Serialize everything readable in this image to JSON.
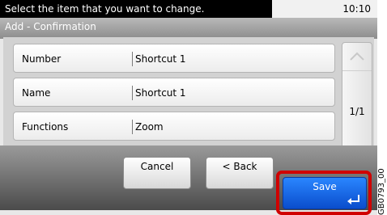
{
  "status": {
    "message": "Select the item that you want to change.",
    "time": "10:10"
  },
  "screen": {
    "title": "Add - Confirmation"
  },
  "fields": [
    {
      "label": "Number",
      "value": "Shortcut 1"
    },
    {
      "label": "Name",
      "value": "Shortcut 1"
    },
    {
      "label": "Functions",
      "value": "Zoom"
    }
  ],
  "pager": {
    "indicator": "1/1"
  },
  "buttons": {
    "cancel": "Cancel",
    "back": "< Back",
    "save": "Save"
  },
  "side_code": "GB0793_00",
  "colors": {
    "save": "#1e6cf0",
    "highlight": "#d00000",
    "bar": "#000000"
  },
  "icons": {
    "up": "chevron-up-icon",
    "down": "chevron-down-icon",
    "enter": "enter-icon"
  }
}
